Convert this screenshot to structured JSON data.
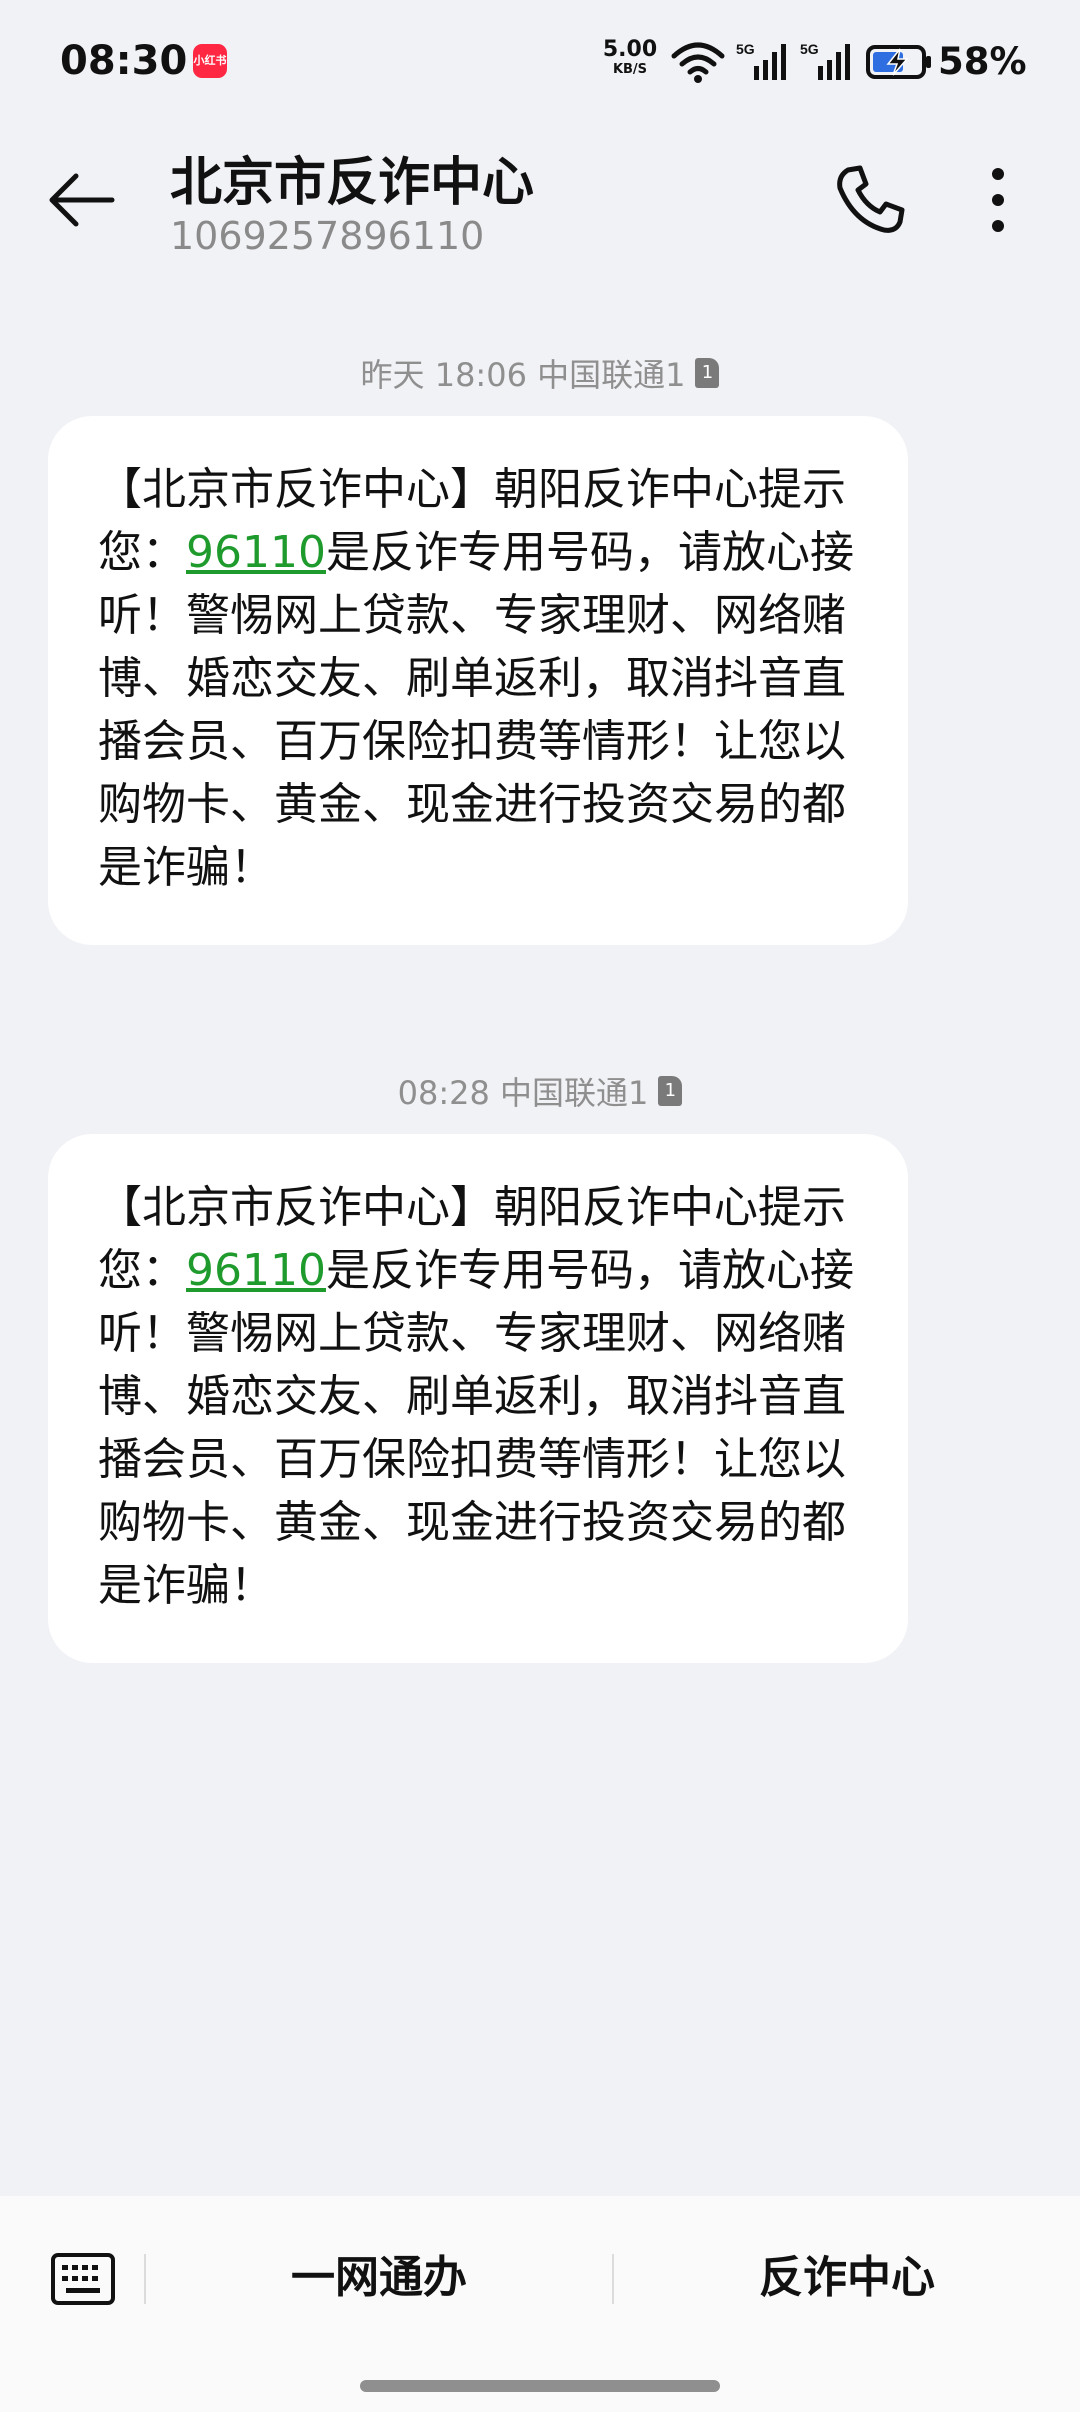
{
  "status_bar": {
    "time": "08:30",
    "app_badge": "小红书",
    "net_speed_value": "5.00",
    "net_speed_unit": "KB/S",
    "sim1_label": "5G",
    "sim2_label": "5G",
    "battery_percent": "58%"
  },
  "header": {
    "contact_name": "北京市反诈中心",
    "phone_number": "1069257896110",
    "icons": [
      "back-arrow-icon",
      "phone-icon",
      "more-vertical-icon"
    ]
  },
  "messages": [
    {
      "timestamp": "昨天 18:06 中国联通1",
      "sim": "1",
      "text_before": "【北京市反诈中心】朝阳反诈中心提示您：",
      "link": "96110",
      "text_after": "是反诈专用号码，请放心接听！警惕网上贷款、专家理财、网络赌博、婚恋交友、刷单返利，取消抖音直播会员、百万保险扣费等情形！让您以购物卡、黄金、现金进行投资交易的都是诈骗！"
    },
    {
      "timestamp": "08:28 中国联通1",
      "sim": "1",
      "text_before": "【北京市反诈中心】朝阳反诈中心提示您：",
      "link": "96110",
      "text_after": "是反诈专用号码，请放心接听！警惕网上贷款、专家理财、网络赌博、婚恋交友、刷单返利，取消抖音直播会员、百万保险扣费等情形！让您以购物卡、黄金、现金进行投资交易的都是诈骗！"
    }
  ],
  "bottom_bar": {
    "keyboard_icon": "keyboard-icon",
    "menu_1": "一网通办",
    "menu_2": "反诈中心"
  },
  "colors": {
    "background": "#f1f2f6",
    "bubble": "#ffffff",
    "link": "#1f9b2e",
    "meta_text": "#8f8f8f"
  }
}
